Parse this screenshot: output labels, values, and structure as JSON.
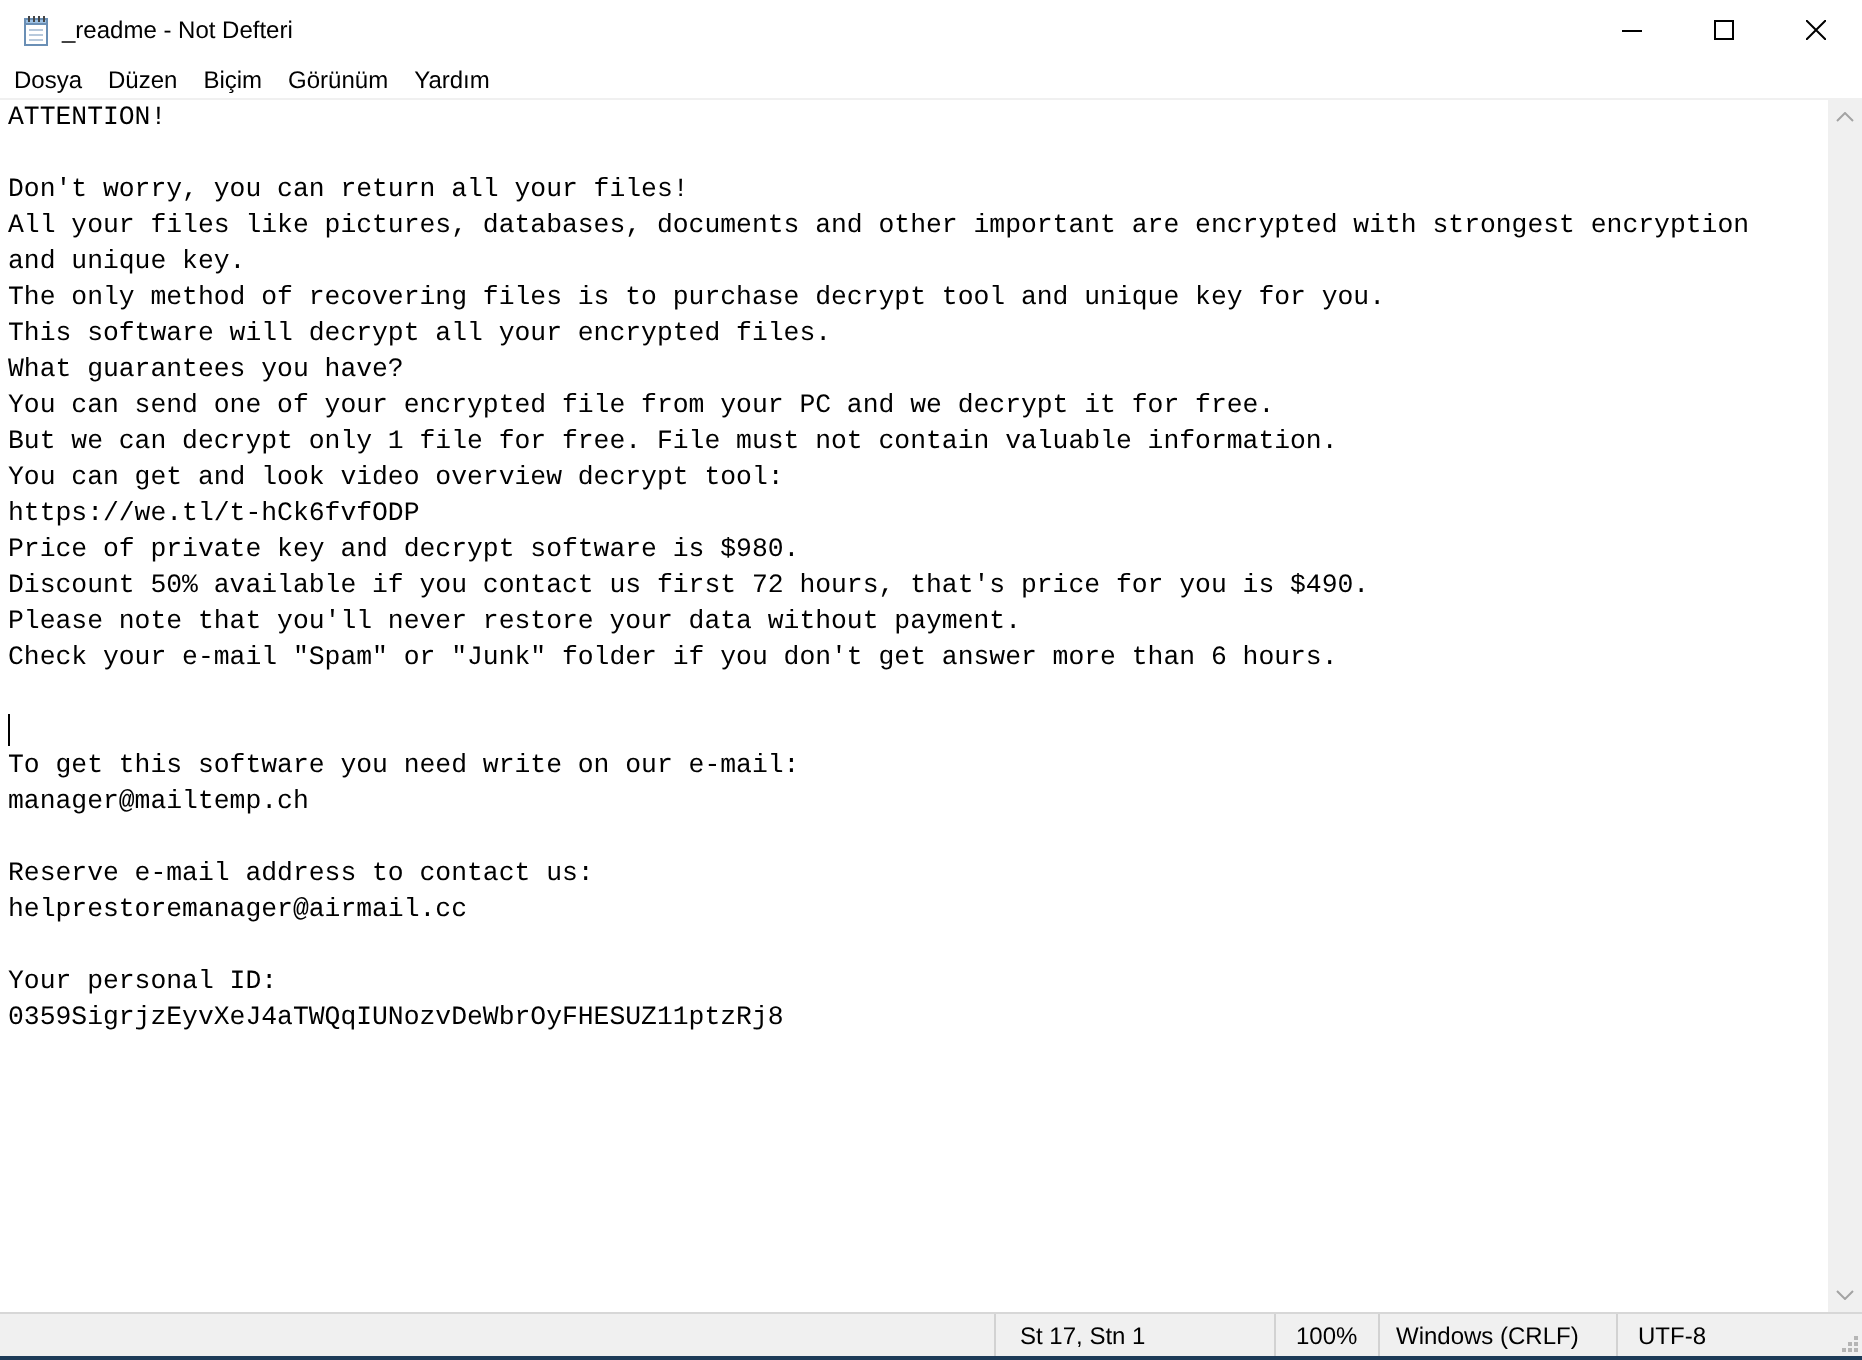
{
  "window": {
    "title": "_readme - Not Defteri"
  },
  "menu": [
    "Dosya",
    "Düzen",
    "Biçim",
    "Görünüm",
    "Yardım"
  ],
  "editor": {
    "lines": [
      {
        "kind": "text",
        "text": "ATTENTION!"
      },
      {
        "kind": "blank"
      },
      {
        "kind": "text",
        "text": "Don't worry, you can return all your files!"
      },
      {
        "kind": "text",
        "text": "All your files like pictures, databases, documents and other important are encrypted with strongest encryption and unique key."
      },
      {
        "kind": "text",
        "text": "The only method of recovering files is to purchase decrypt tool and unique key for you."
      },
      {
        "kind": "text",
        "text": "This software will decrypt all your encrypted files."
      },
      {
        "kind": "text",
        "text": "What guarantees you have?"
      },
      {
        "kind": "text",
        "text": "You can send one of your encrypted file from your PC and we decrypt it for free."
      },
      {
        "kind": "text",
        "text": "But we can decrypt only 1 file for free. File must not contain valuable information."
      },
      {
        "kind": "text",
        "text": "You can get and look video overview decrypt tool:"
      },
      {
        "kind": "text",
        "text": "https://we.tl/t-hCk6fvfODP"
      },
      {
        "kind": "text",
        "text": "Price of private key and decrypt software is $980."
      },
      {
        "kind": "text",
        "text": "Discount 50% available if you contact us first 72 hours, that's price for you is $490."
      },
      {
        "kind": "text",
        "text": "Please note that you'll never restore your data without payment."
      },
      {
        "kind": "text",
        "text": "Check your e-mail \"Spam\" or \"Junk\" folder if you don't get answer more than 6 hours."
      },
      {
        "kind": "blank"
      },
      {
        "kind": "caret"
      },
      {
        "kind": "text",
        "text": "To get this software you need write on our e-mail:"
      },
      {
        "kind": "text",
        "text": "manager@mailtemp.ch"
      },
      {
        "kind": "blank"
      },
      {
        "kind": "text",
        "text": "Reserve e-mail address to contact us:"
      },
      {
        "kind": "text",
        "text": "helprestoremanager@airmail.cc"
      },
      {
        "kind": "blank"
      },
      {
        "kind": "text",
        "text": "Your personal ID:"
      },
      {
        "kind": "text",
        "text": "0359SigrjzEyvXeJ4aTWQqIUNozvDeWbrOyFHESUZ11ptzRj8"
      }
    ]
  },
  "status_bar": [
    "St 17, Stn 1",
    "100%",
    "Windows (CRLF)",
    "UTF-8"
  ]
}
